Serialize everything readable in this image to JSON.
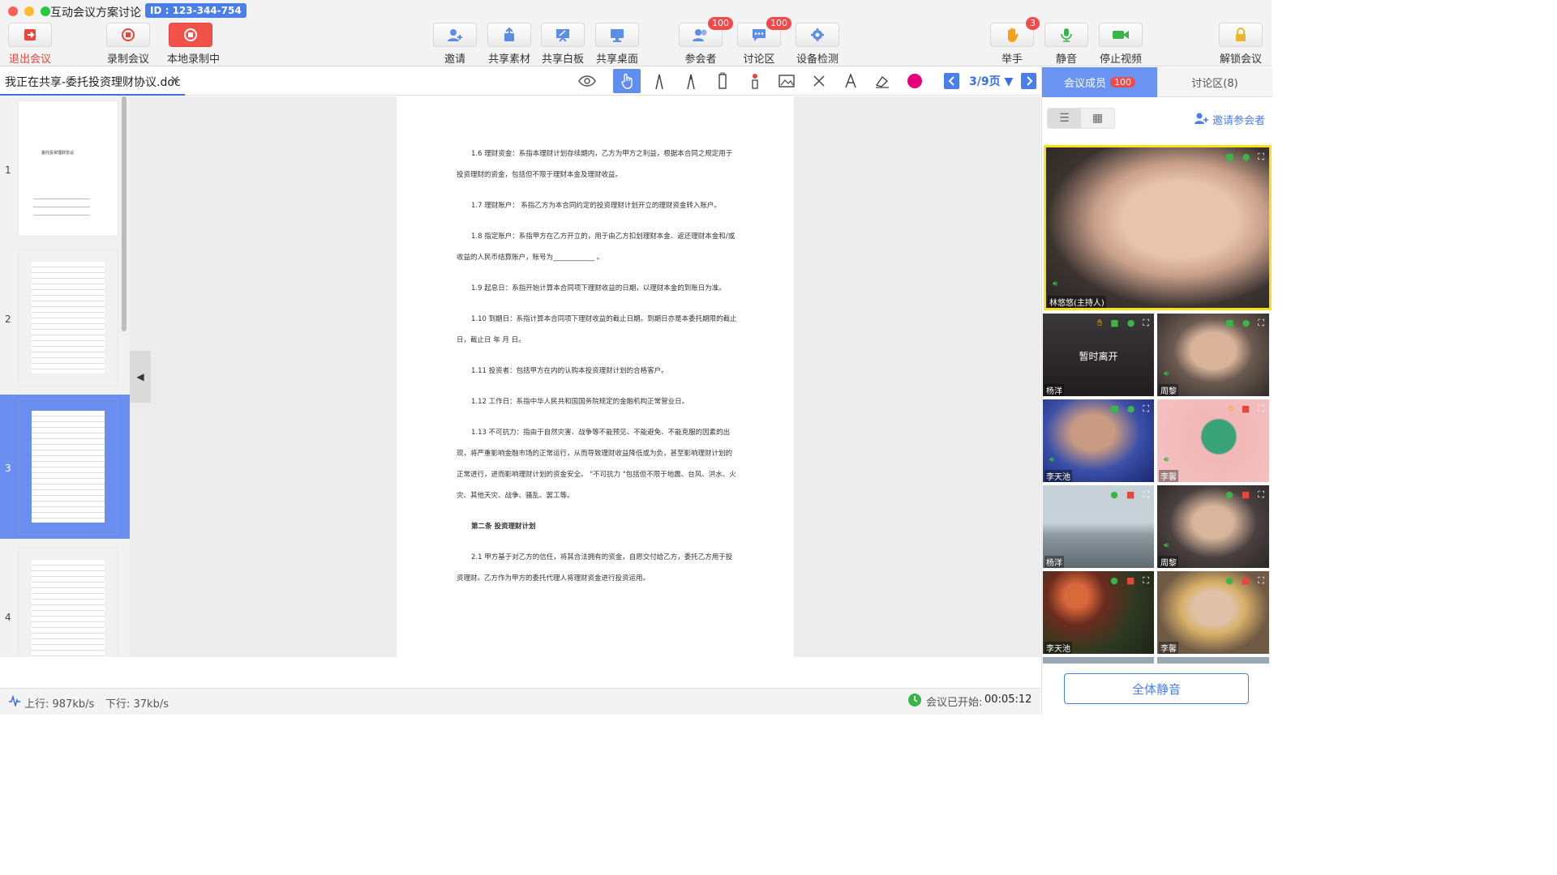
{
  "window": {
    "title": "互动会议方案讨论 -",
    "meeting_id": "ID : 123-344-754"
  },
  "toolbar": {
    "exit": "退出会议",
    "record": "录制会议",
    "local_record": "本地录制中",
    "invite": "邀请",
    "share_material": "共享素材",
    "share_whiteboard": "共享白板",
    "share_desktop": "共享桌面",
    "participants": "参会者",
    "participants_badge": "100",
    "discussion": "讨论区",
    "discussion_badge": "100",
    "device_check": "设备检测",
    "raise_hand": "举手",
    "raise_hand_badge": "3",
    "mute": "静音",
    "stop_video": "停止视频",
    "unlock": "解锁会议"
  },
  "doc": {
    "tab_title": "我正在共享-委托投资理财协议.doc",
    "page_indicator": "3/9页",
    "thumb_numbers": [
      "1",
      "2",
      "3",
      "4"
    ],
    "thumb1_title": "委托投资理财协议",
    "paragraphs": [
      "1.6  理财资金：系指本理财计划存续期内，乙方为甲方之利益，根据本合同之规定用于投资理财的资金，包括但不限于理财本金及理财收益。",
      "1.7  理财账户：  系指乙方为本合同约定的投资理财计划开立的理财资金转入账户。",
      "1.8  指定账户：系指甲方在乙方开立的，用于由乙方扣划理财本金、返还理财本金和/或收益的人民币结算账户，账号为____________ 。",
      "1.9  起息日：系指开始计算本合同项下理财收益的日期，以理财本金的到账日为准。",
      "1.10  到期日：系指计算本合同项下理财收益的截止日期。到期日亦是本委托期限的截止日，截止日  年  月  日。",
      "1.11  投资者：包括甲方在内的认购本投资理财计划的合格客户。",
      "1.12  工作日：系指中华人民共和国国务院规定的金融机构正常营业日。",
      "1.13  不可抗力：指由于自然灾害、战争等不能预见、不能避免、不能克服的因素的出现，将严重影响金融市场的正常运行，从而导致理财收益降低或为负，甚至影响理财计划的正常进行，进而影响理财计划的资金安全。 \"不可抗力 \"包括但不限于地震、台风、洪水、火灾、其他天灾、战争、骚乱、罢工等。",
      "第二条  投资理财计划",
      "2.1  甲方基于对乙方的信任，将其合法拥有的资金，自愿交付给乙方，委托乙方用于投资理财。乙方作为甲方的委托代理人将理财资金进行投资运用。"
    ]
  },
  "status": {
    "upload": "上行: 987kb/s",
    "download": "下行: 37kb/s",
    "meeting_started": "会议已开始:",
    "elapsed": "00:05:12"
  },
  "panel": {
    "members_tab": "会议成员",
    "members_count": "100",
    "discussion_tab": "讨论区(8)",
    "invite_link": "邀请参会者",
    "mute_all": "全体静音",
    "host_name": "林悠悠(主持人)",
    "away_text": "暂时离开",
    "tiles": [
      "杨洋",
      "周黎",
      "李天池",
      "李馨",
      "杨洋",
      "周黎",
      "李天池",
      "李馨"
    ]
  },
  "colors": {
    "accent": "#4a7ee8",
    "record_red": "#f0524a",
    "badge_red": "#f04a4a",
    "host_border": "#f5e21a"
  }
}
